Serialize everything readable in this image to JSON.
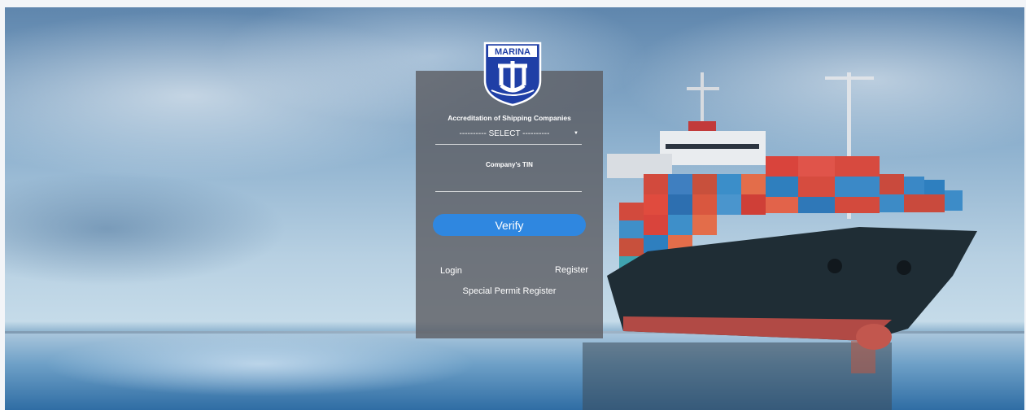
{
  "logo": {
    "text": "MARINA"
  },
  "form": {
    "title": "Accreditation of Shipping Companies",
    "select_value": "---------- SELECT ----------",
    "tin_label": "Company's TIN",
    "tin_value": "",
    "verify_label": "Verify",
    "login_label": "Login",
    "register_label": "Register",
    "special_permit_label": "Special Permit Register"
  },
  "colors": {
    "verify_button": "#2f87e0",
    "panel": "#5a5a5f",
    "logo_blue": "#1f3fa6"
  },
  "icons": [
    "dropdown-arrow-icon"
  ]
}
